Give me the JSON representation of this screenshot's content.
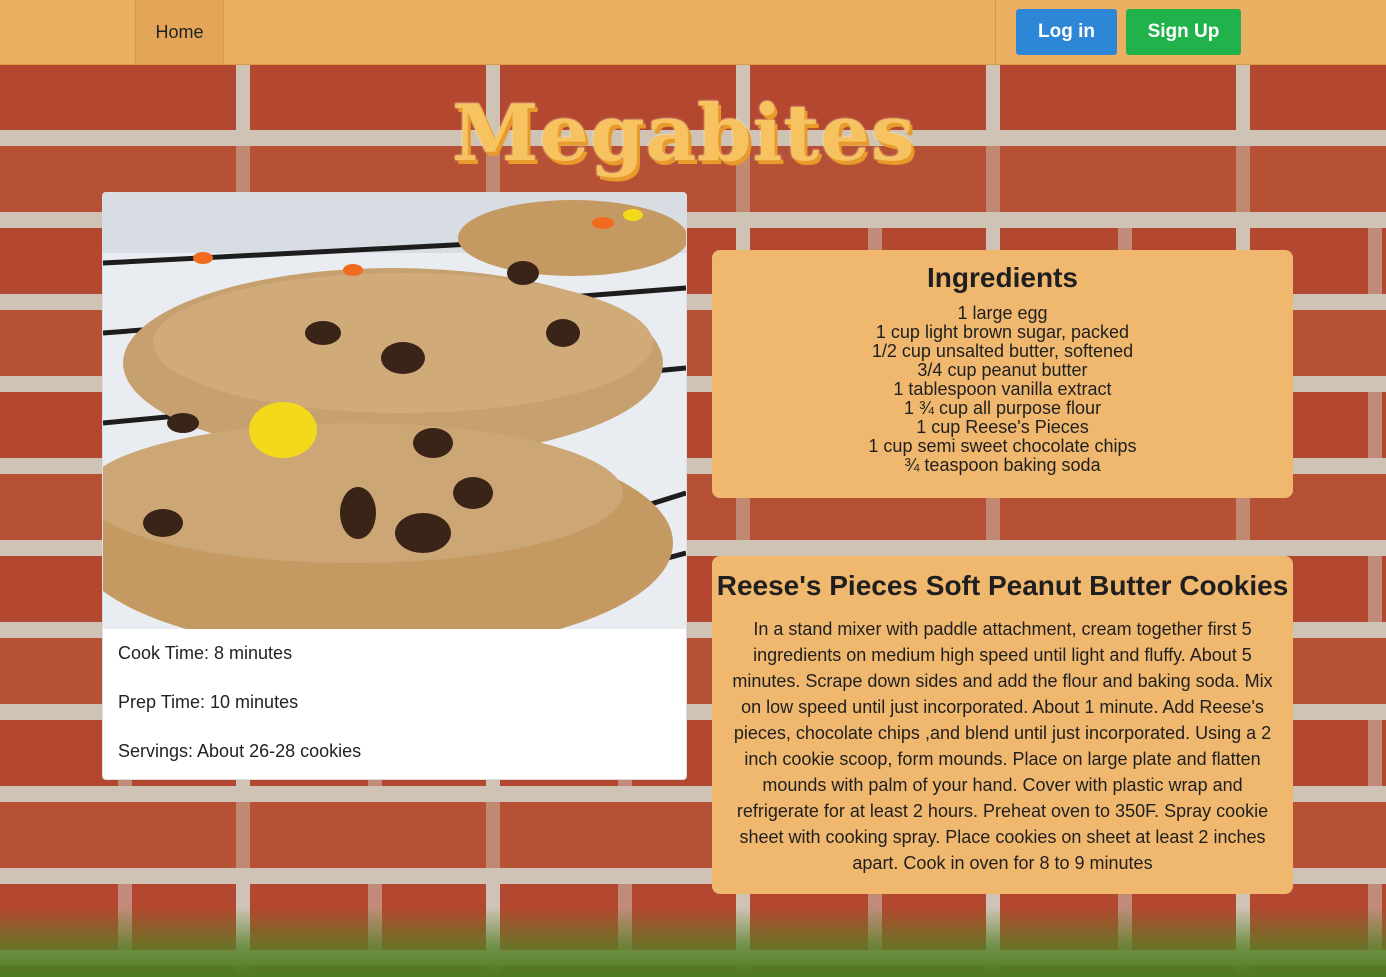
{
  "nav": {
    "home_label": "Home",
    "login_label": "Log in",
    "signup_label": "Sign Up"
  },
  "logo_text": "Megabites",
  "recipe": {
    "title": "Reese's Pieces Soft Peanut Butter Cookies",
    "cook_time": "Cook Time: 8 minutes",
    "prep_time": "Prep Time: 10 minutes",
    "servings": "Servings: About 26-28 cookies",
    "ingredients_heading": "Ingredients",
    "ingredients": [
      "1 large egg",
      "1 cup light brown sugar, packed",
      "1/2 cup unsalted butter, softened",
      "3/4 cup peanut butter",
      "1 tablespoon vanilla extract",
      "1 ¾ cup all purpose flour",
      "1 cup Reese's Pieces",
      "1 cup semi sweet chocolate chips",
      "¾ teaspoon baking soda"
    ],
    "directions": "In a stand mixer with paddle attachment, cream together first 5 ingredients on medium high speed until light and fluffy. About 5 minutes. Scrape down sides and add the flour and baking soda. Mix on low speed until just incorporated. About 1 minute. Add Reese's pieces, chocolate chips ,and blend until just incorporated. Using a 2 inch cookie scoop, form mounds. Place on large plate and flatten mounds with palm of your hand. Cover with plastic wrap and refrigerate for at least 2 hours. Preheat oven to 350F. Spray cookie sheet with cooking spray. Place cookies on sheet at least 2 inches apart. Cook in oven for 8 to 9 minutes"
  },
  "colors": {
    "navbar": "#ebb061",
    "panel": "#f0b86f",
    "login_button": "#2e86d6",
    "signup_button": "#21b24b",
    "logo": "#f7c260"
  }
}
